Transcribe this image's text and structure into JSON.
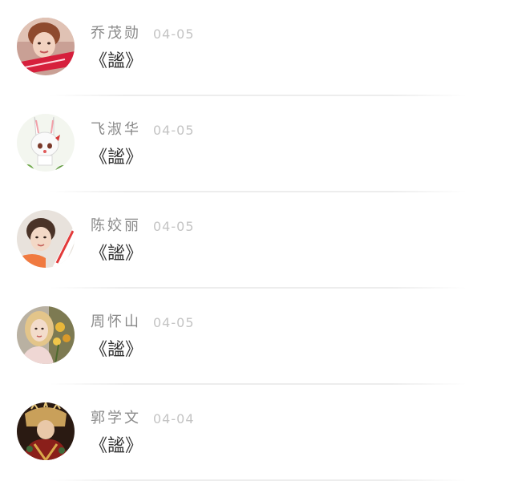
{
  "comments": [
    {
      "name": "乔茂勋",
      "date": "04-05",
      "text": "《謐》",
      "avatar_icon": "avatar-woman-red-sash-icon"
    },
    {
      "name": "飞淑华",
      "date": "04-05",
      "text": "《謐》",
      "avatar_icon": "avatar-bunny-girl-illustration-icon"
    },
    {
      "name": "陈姣丽",
      "date": "04-05",
      "text": "《謐》",
      "avatar_icon": "avatar-woman-orange-sash-icon"
    },
    {
      "name": "周怀山",
      "date": "04-05",
      "text": "《謐》",
      "avatar_icon": "avatar-blonde-woman-flowers-icon"
    },
    {
      "name": "郭学文",
      "date": "04-04",
      "text": "《謐》",
      "avatar_icon": "avatar-costumed-figure-icon"
    }
  ]
}
